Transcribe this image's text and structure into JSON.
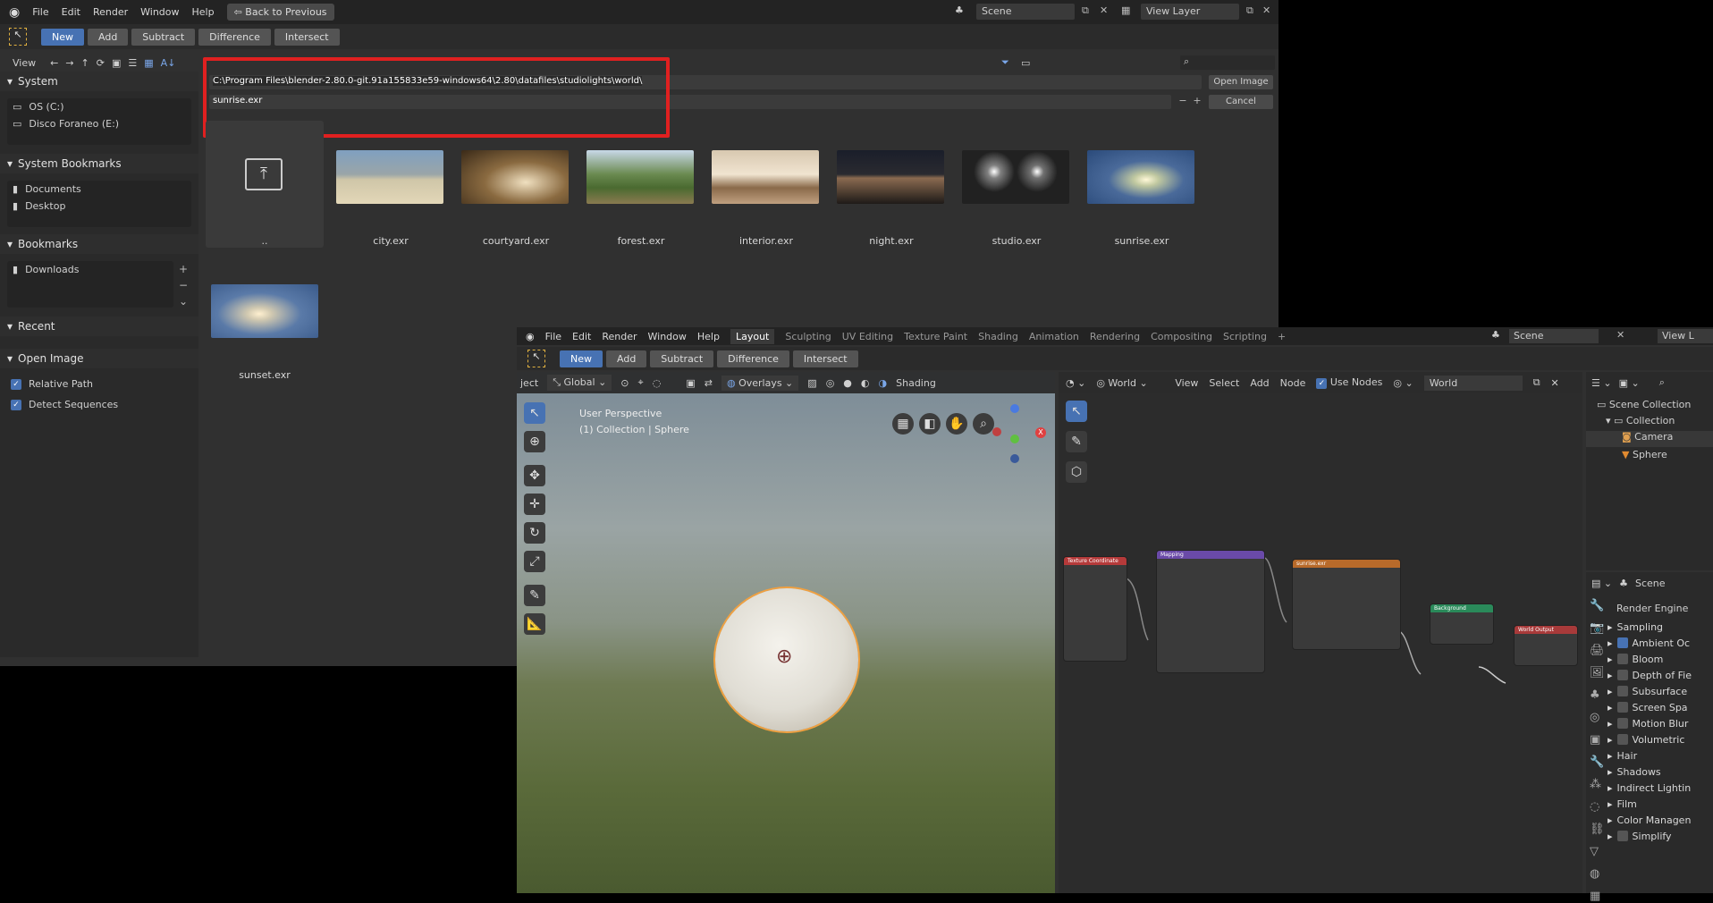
{
  "file_browser": {
    "menu": [
      "File",
      "Edit",
      "Render",
      "Window",
      "Help"
    ],
    "back_button": "Back to Previous",
    "scene": "Scene",
    "view_layer": "View Layer",
    "modes": [
      "New",
      "Add",
      "Subtract",
      "Difference",
      "Intersect"
    ],
    "view_label": "View",
    "path": "C:\\Program Files\\blender-2.80.0-git.91a155833e59-windows64\\2.80\\datafiles\\studiolights\\world\\",
    "filename": "sunrise.exr",
    "open_button": "Open Image",
    "cancel_button": "Cancel",
    "sections": {
      "system": "System",
      "system_items": [
        "OS (C:)",
        "Disco Foraneo (E:)"
      ],
      "system_bookmarks": "System Bookmarks",
      "system_bookmark_items": [
        "Documents",
        "Desktop"
      ],
      "bookmarks": "Bookmarks",
      "bookmark_items": [
        "Downloads"
      ],
      "recent": "Recent",
      "open_image": "Open Image",
      "options": [
        "Relative Path",
        "Detect Sequences"
      ]
    },
    "parent_dir_label": "..",
    "files": [
      "city.exr",
      "courtyard.exr",
      "forest.exr",
      "interior.exr",
      "night.exr",
      "studio.exr",
      "sunrise.exr",
      "sunset.exr"
    ]
  },
  "main_window": {
    "menu": [
      "File",
      "Edit",
      "Render",
      "Window",
      "Help"
    ],
    "workspaces": [
      "Layout",
      "Sculpting",
      "UV Editing",
      "Texture Paint",
      "Shading",
      "Animation",
      "Rendering",
      "Compositing",
      "Scripting"
    ],
    "scene": "Scene",
    "view_layer": "View L",
    "modes": [
      "New",
      "Add",
      "Subtract",
      "Difference",
      "Intersect"
    ],
    "viewport": {
      "object_menu": "ject",
      "transform": "Global",
      "overlays": "Overlays",
      "shading": "Shading",
      "perspective": "User Perspective",
      "collection": "(1) Collection | Sphere"
    },
    "node_editor": {
      "world_type": "World",
      "menu": [
        "View",
        "Select",
        "Add",
        "Node"
      ],
      "use_nodes": "Use Nodes",
      "world_name": "World",
      "nodes": [
        "Texture Coordinate",
        "Mapping",
        "sunrise.exr",
        "Background",
        "World Output"
      ]
    },
    "outliner": {
      "scene_collection": "Scene Collection",
      "collection": "Collection",
      "items": [
        "Camera",
        "Sphere"
      ]
    },
    "properties": {
      "scene": "Scene",
      "render_engine": "Render Engine",
      "panels": [
        {
          "label": "Sampling",
          "checkbox": "none"
        },
        {
          "label": "Ambient Oc",
          "checkbox": "on"
        },
        {
          "label": "Bloom",
          "checkbox": "off"
        },
        {
          "label": "Depth of Fie",
          "checkbox": "off"
        },
        {
          "label": "Subsurface",
          "checkbox": "off"
        },
        {
          "label": "Screen Spa",
          "checkbox": "off"
        },
        {
          "label": "Motion Blur",
          "checkbox": "off"
        },
        {
          "label": "Volumetric",
          "checkbox": "off"
        },
        {
          "label": "Hair",
          "checkbox": "none"
        },
        {
          "label": "Shadows",
          "checkbox": "none"
        },
        {
          "label": "Indirect Lightin",
          "checkbox": "none"
        },
        {
          "label": "Film",
          "checkbox": "none"
        },
        {
          "label": "Color Managen",
          "checkbox": "none"
        },
        {
          "label": "Simplify",
          "checkbox": "off"
        }
      ]
    }
  },
  "colors": {
    "accent": "#4772b3",
    "highlight": "#e02020",
    "panel": "#303030",
    "header": "#232323"
  }
}
